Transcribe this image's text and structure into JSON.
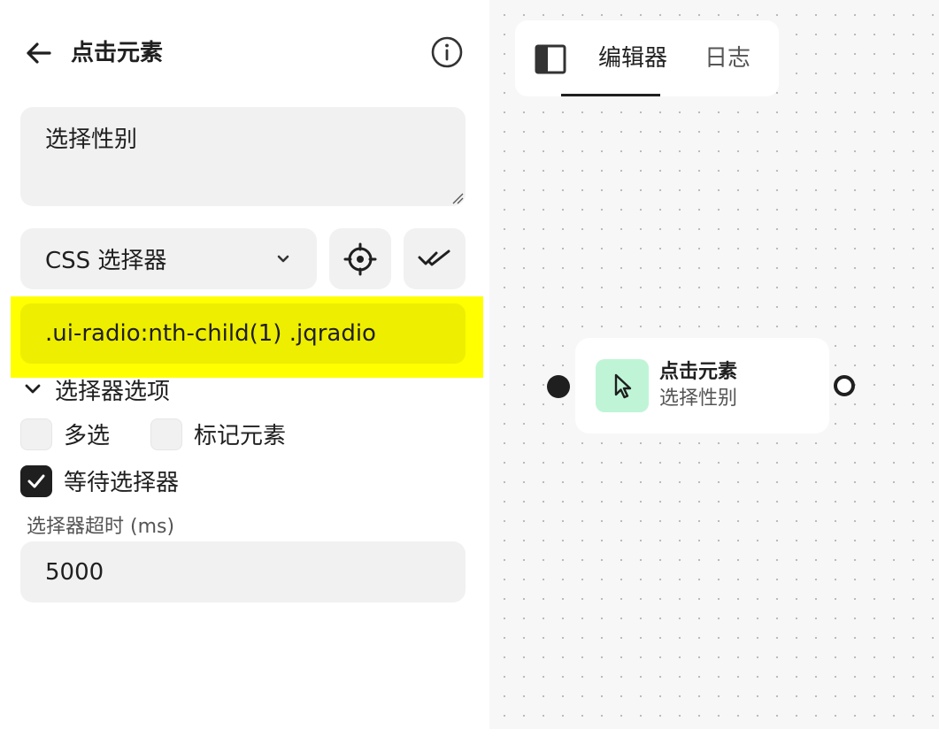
{
  "panel": {
    "title": "点击元素",
    "description": "选择性别",
    "selector_type": "CSS 选择器",
    "selector_value": ".ui-radio:nth-child(1) .jqradio",
    "options_toggle_label": "选择器选项",
    "options": {
      "multiple_label": "多选",
      "multiple_checked": false,
      "mark_element_label": "标记元素",
      "mark_element_checked": false,
      "wait_selector_label": "等待选择器",
      "wait_selector_checked": true
    },
    "timeout_label": "选择器超时 (ms)",
    "timeout_value": "5000",
    "highlight_color": "#ffff00"
  },
  "canvas": {
    "tabs": [
      {
        "label": "编辑器",
        "active": true
      },
      {
        "label": "日志",
        "active": false
      }
    ],
    "node": {
      "title": "点击元素",
      "subtitle": "选择性别",
      "icon": "cursor-click-icon",
      "icon_bg": "#bff5d6"
    }
  }
}
